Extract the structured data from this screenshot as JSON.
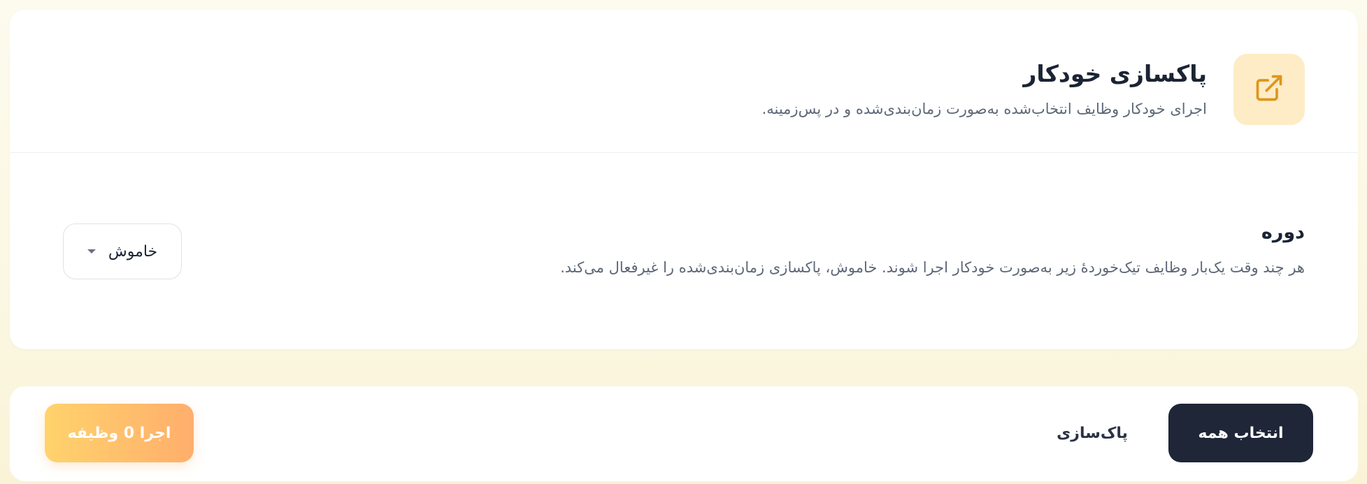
{
  "header": {
    "title": "پاکسازی خودکار",
    "subtitle": "اجرای خودکار وظایف انتخاب‌شده به‌صورت زمان‌بندی‌شده و در پس‌زمینه.",
    "icon": "external-link-icon",
    "icon_color": "#e0951a",
    "icon_bg": "#fdecc6"
  },
  "period": {
    "title": "دوره",
    "description": "هر چند وقت یک‌بار وظایف تیک‌خوردهٔ زیر به‌صورت خودکار اجرا شوند. خاموش، پاکسازی زمان‌بندی‌شده را غیرفعال می‌کند.",
    "selected_value": "خاموش"
  },
  "actions": {
    "select_all_label": "انتخاب همه",
    "clean_label": "پاک‌سازی",
    "run_label": "اجرا 0 وظیفه"
  },
  "colors": {
    "dark_button": "#1e2638",
    "run_gradient_start": "#ffd36c",
    "run_gradient_end": "#ffae6c"
  }
}
